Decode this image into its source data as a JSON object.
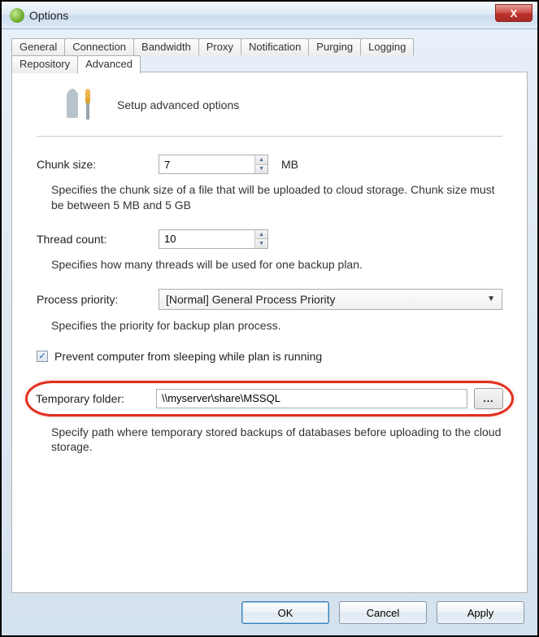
{
  "window": {
    "title": "Options",
    "close_label": "X"
  },
  "tabs": {
    "row1": [
      "General",
      "Connection",
      "Bandwidth",
      "Proxy",
      "Notification",
      "Purging",
      "Logging"
    ],
    "row2": [
      "Repository",
      "Advanced"
    ],
    "active": "Advanced"
  },
  "header": {
    "text": "Setup advanced options"
  },
  "chunk": {
    "label": "Chunk size:",
    "value": "7",
    "unit": "MB",
    "help": "Specifies the chunk size of a file that will be uploaded to cloud storage. Chunk size must be between 5 MB and 5 GB"
  },
  "threads": {
    "label": "Thread count:",
    "value": "10",
    "help": "Specifies how many threads will be used for one backup plan."
  },
  "priority": {
    "label": "Process priority:",
    "value": "[Normal] General Process Priority",
    "help": "Specifies the priority for backup plan process."
  },
  "sleep": {
    "checked": true,
    "label": "Prevent computer from sleeping while plan is running"
  },
  "temp": {
    "label": "Temporary folder:",
    "value": "\\\\myserver\\share\\MSSQL",
    "browse": "...",
    "help": "Specify path where temporary stored backups of databases before uploading to the cloud storage."
  },
  "buttons": {
    "ok": "OK",
    "cancel": "Cancel",
    "apply": "Apply"
  }
}
